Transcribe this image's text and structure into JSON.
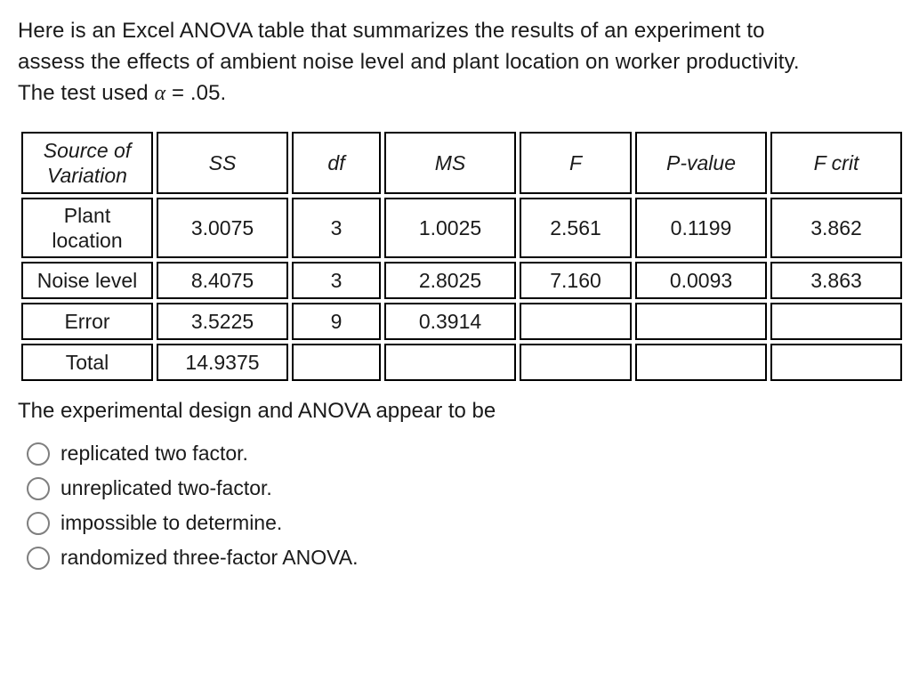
{
  "intro": {
    "line1": "Here is an Excel ANOVA table that summarizes the results of an experiment to",
    "line2": "assess the effects of ambient noise level and plant location on worker productivity.",
    "line3_pre": "The test used ",
    "alpha_sym": "α",
    "line3_post": " = .05."
  },
  "table": {
    "headers": {
      "source_l1": "Source of",
      "source_l2": "Variation",
      "ss": "SS",
      "df": "df",
      "ms": "MS",
      "f": "F",
      "p": "P-value",
      "fcrit": "F crit"
    },
    "rows": {
      "plant": {
        "label_l1": "Plant",
        "label_l2": "location",
        "ss": "3.0075",
        "df": "3",
        "ms": "1.0025",
        "f": "2.561",
        "p": "0.1199",
        "fcrit": "3.862"
      },
      "noise": {
        "label": "Noise level",
        "ss": "8.4075",
        "df": "3",
        "ms": "2.8025",
        "f": "7.160",
        "p": "0.0093",
        "fcrit": "3.863"
      },
      "error": {
        "label": "Error",
        "ss": "3.5225",
        "df": "9",
        "ms": "0.3914",
        "f": "",
        "p": "",
        "fcrit": ""
      },
      "total": {
        "label": "Total",
        "ss": "14.9375",
        "df": "",
        "ms": "",
        "f": "",
        "p": "",
        "fcrit": ""
      }
    }
  },
  "followup": "The experimental design and ANOVA appear to be",
  "options": {
    "a": "replicated two factor.",
    "b": "unreplicated two-factor.",
    "c": "impossible to determine.",
    "d": "randomized three-factor ANOVA."
  },
  "chart_data": {
    "type": "table",
    "title": "ANOVA summary",
    "columns": [
      "Source of Variation",
      "SS",
      "df",
      "MS",
      "F",
      "P-value",
      "F crit"
    ],
    "rows": [
      [
        "Plant location",
        3.0075,
        3,
        1.0025,
        2.561,
        0.1199,
        3.862
      ],
      [
        "Noise level",
        8.4075,
        3,
        2.8025,
        7.16,
        0.0093,
        3.863
      ],
      [
        "Error",
        3.5225,
        9,
        0.3914,
        null,
        null,
        null
      ],
      [
        "Total",
        14.9375,
        null,
        null,
        null,
        null,
        null
      ]
    ],
    "alpha": 0.05
  }
}
